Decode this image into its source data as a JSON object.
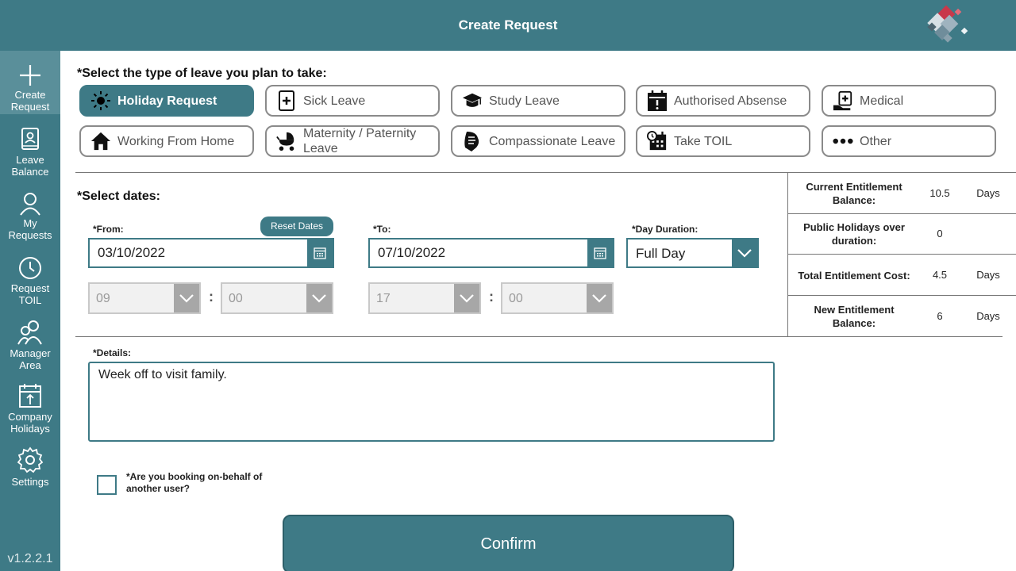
{
  "header": {
    "title": "Create Request"
  },
  "sidebar": {
    "items": [
      {
        "label_1": "Create",
        "label_2": "Request",
        "icon": "plus-icon",
        "active": true
      },
      {
        "label_1": "Leave",
        "label_2": "Balance",
        "icon": "book-icon"
      },
      {
        "label_1": "My",
        "label_2": "Requests",
        "icon": "user-icon"
      },
      {
        "label_1": "Request",
        "label_2": "TOIL",
        "icon": "clock-icon"
      },
      {
        "label_1": "Manager",
        "label_2": "Area",
        "icon": "users-icon"
      },
      {
        "label_1": "Company",
        "label_2": "Holidays",
        "icon": "calendar-icon"
      },
      {
        "label_1": "Settings",
        "label_2": "",
        "icon": "gear-icon"
      }
    ],
    "version": "v1.2.2.1"
  },
  "leave_type": {
    "heading": "*Select the type of leave you plan to take:",
    "options": [
      {
        "label": "Holiday Request",
        "icon": "sun-icon",
        "selected": true
      },
      {
        "label": "Sick Leave",
        "icon": "medical-book-icon"
      },
      {
        "label": "Study Leave",
        "icon": "graduation-cap-icon"
      },
      {
        "label": "Authorised Absense",
        "icon": "calendar-alert-icon"
      },
      {
        "label": "Medical",
        "icon": "medical-kit-icon"
      },
      {
        "label": "Working From Home",
        "icon": "house-icon"
      },
      {
        "label": "Maternity / Paternity Leave",
        "icon": "stroller-icon"
      },
      {
        "label": "Compassionate Leave",
        "icon": "hands-icon"
      },
      {
        "label": "Take TOIL",
        "icon": "calendar-clock-icon"
      },
      {
        "label": "Other",
        "icon": "more-dots-icon"
      }
    ]
  },
  "dates": {
    "heading": "*Select dates:",
    "from_label": "*From:",
    "from_value": "03/10/2022",
    "to_label": "*To:",
    "to_value": "07/10/2022",
    "reset_label": "Reset Dates",
    "duration_label": "*Day Duration:",
    "duration_value": "Full Day",
    "from_hour": "09",
    "from_minute": "00",
    "to_hour": "17",
    "to_minute": "00",
    "colon": ":"
  },
  "entitlement": {
    "rows": [
      {
        "label": "Current Entitlement Balance:",
        "value": "10.5",
        "unit": "Days"
      },
      {
        "label": "Public Holidays over duration:",
        "value": "0",
        "unit": ""
      },
      {
        "label": "Total Entitlement Cost:",
        "value": "4.5",
        "unit": "Days"
      },
      {
        "label": "New Entitlement Balance:",
        "value": "6",
        "unit": "Days"
      }
    ]
  },
  "details": {
    "label": "*Details:",
    "value": "Week off to visit family."
  },
  "behalf": {
    "label": "*Are you booking on-behalf of another user?",
    "checked": false
  },
  "confirm": {
    "label": "Confirm"
  },
  "colors": {
    "primary": "#3e7a86",
    "active_nav": "#5a8f9a",
    "disabled": "#f1f1f1"
  }
}
